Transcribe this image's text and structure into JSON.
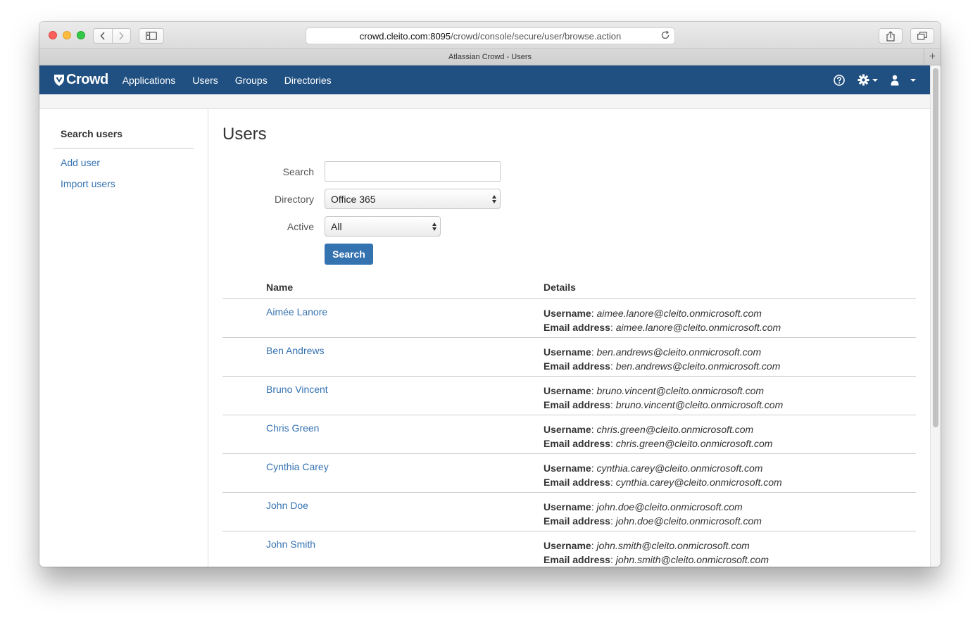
{
  "browser": {
    "url_host": "crowd.cleito.com:8095",
    "url_path": "/crowd/console/secure/user/browse.action",
    "tab_title": "Atlassian Crowd - Users",
    "new_tab_label": "+"
  },
  "app": {
    "logo_text": "Crowd",
    "nav": [
      "Applications",
      "Users",
      "Groups",
      "Directories"
    ],
    "header_icons": [
      "help-icon",
      "gear-icon",
      "user-icon"
    ]
  },
  "sidebar": {
    "heading": "Search users",
    "links": [
      "Add user",
      "Import users"
    ]
  },
  "main": {
    "title": "Users",
    "form": {
      "search_label": "Search",
      "search_value": "",
      "directory_label": "Directory",
      "directory_value": "Office 365",
      "active_label": "Active",
      "active_value": "All",
      "submit_label": "Search"
    },
    "table": {
      "headers": {
        "name": "Name",
        "details": "Details"
      },
      "username_label": "Username",
      "email_label": "Email address",
      "rows": [
        {
          "name": "Aimée Lanore",
          "username": "aimee.lanore@cleito.onmicrosoft.com",
          "email": "aimee.lanore@cleito.onmicrosoft.com"
        },
        {
          "name": "Ben Andrews",
          "username": "ben.andrews@cleito.onmicrosoft.com",
          "email": "ben.andrews@cleito.onmicrosoft.com"
        },
        {
          "name": "Bruno Vincent",
          "username": "bruno.vincent@cleito.onmicrosoft.com",
          "email": "bruno.vincent@cleito.onmicrosoft.com"
        },
        {
          "name": "Chris Green",
          "username": "chris.green@cleito.onmicrosoft.com",
          "email": "chris.green@cleito.onmicrosoft.com"
        },
        {
          "name": "Cynthia Carey",
          "username": "cynthia.carey@cleito.onmicrosoft.com",
          "email": "cynthia.carey@cleito.onmicrosoft.com"
        },
        {
          "name": "John Doe",
          "username": "john.doe@cleito.onmicrosoft.com",
          "email": "john.doe@cleito.onmicrosoft.com"
        },
        {
          "name": "John Smith",
          "username": "john.smith@cleito.onmicrosoft.com",
          "email": "john.smith@cleito.onmicrosoft.com"
        }
      ]
    }
  },
  "colors": {
    "header_bg": "#205081",
    "link": "#3572b0",
    "button": "#3572b0"
  }
}
